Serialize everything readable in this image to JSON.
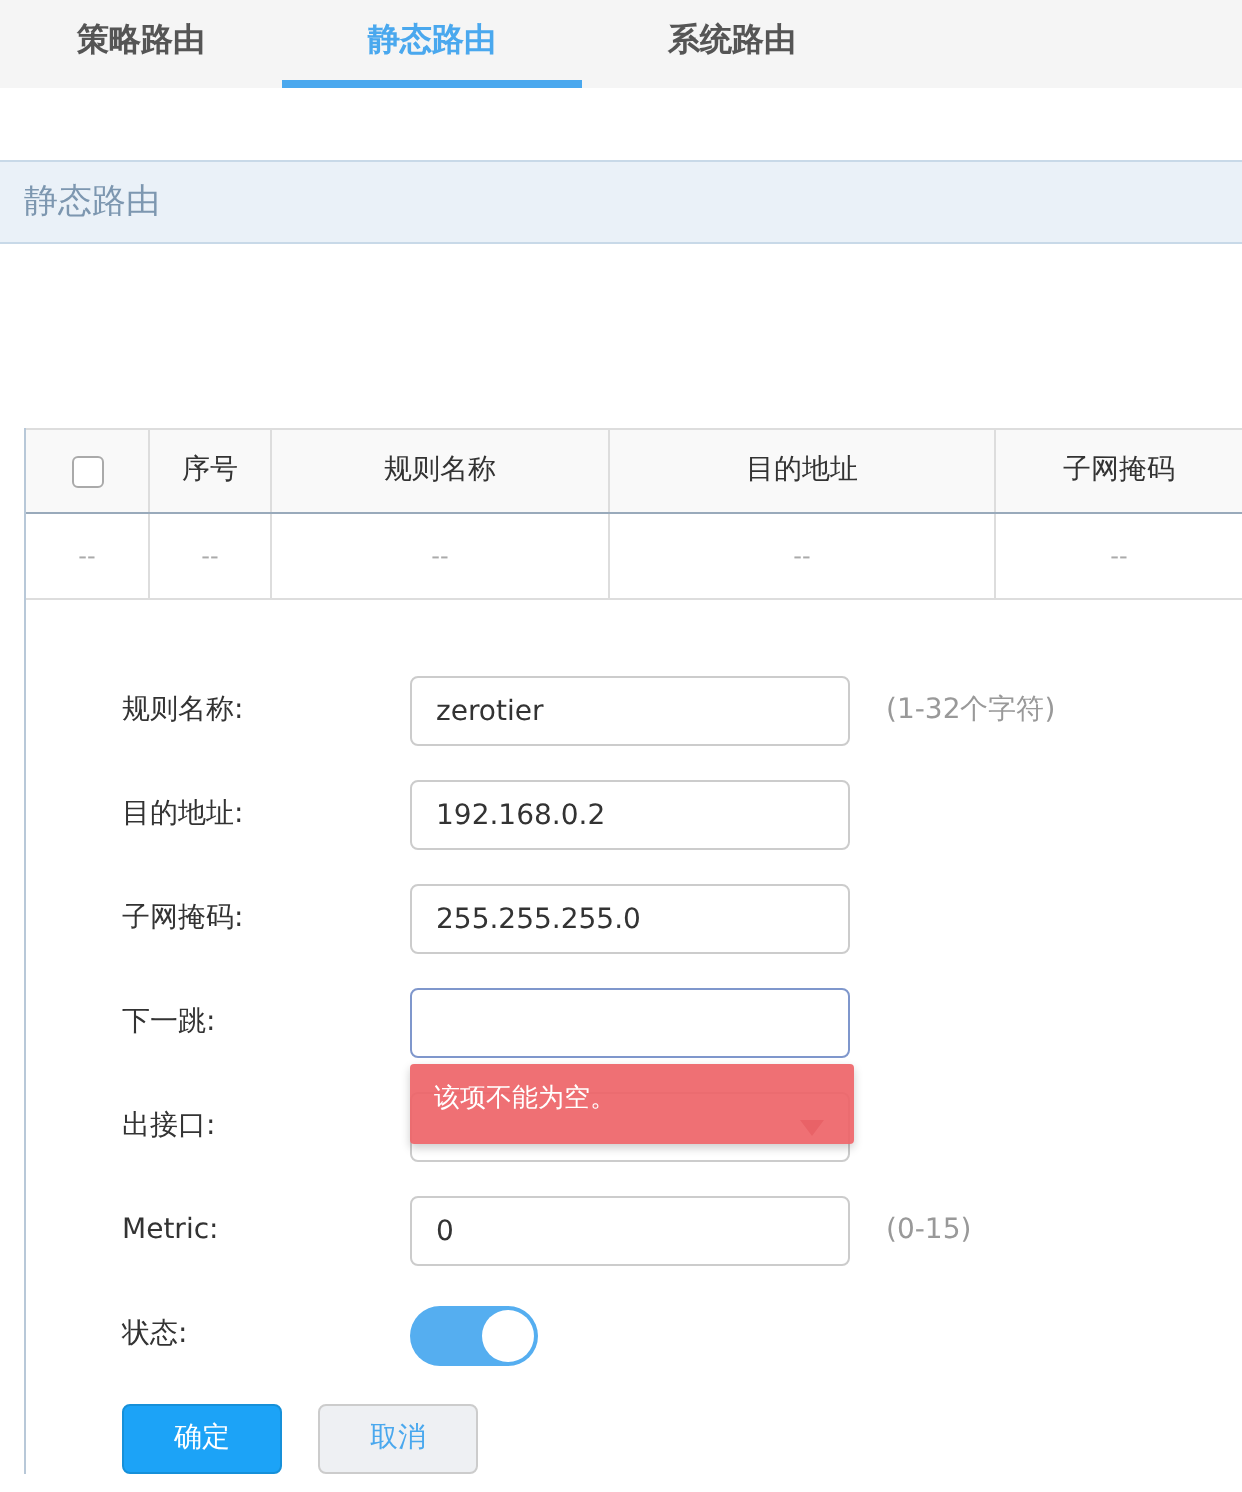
{
  "tabs": [
    {
      "label": "策略路由",
      "selected": false
    },
    {
      "label": "静态路由",
      "selected": true
    },
    {
      "label": "系统路由",
      "selected": false
    }
  ],
  "section_title": "静态路由",
  "table": {
    "select_all_checked": false,
    "columns": [
      "序号",
      "规则名称",
      "目的地址",
      "子网掩码"
    ],
    "rows": [
      {
        "check_cell": "--",
        "cells": [
          "--",
          "--",
          "--",
          "--"
        ]
      }
    ]
  },
  "form": {
    "fields": [
      {
        "kind": "text",
        "label": "规则名称:",
        "value": "zerotier",
        "hint": "(1-32个字符)",
        "focused": false
      },
      {
        "kind": "text",
        "label": "目的地址:",
        "value": "192.168.0.2",
        "focused": false
      },
      {
        "kind": "text",
        "label": "子网掩码:",
        "value": "255.255.255.0",
        "focused": false
      },
      {
        "kind": "text",
        "label": "下一跳:",
        "focused": true,
        "error": "该项不能为空。"
      },
      {
        "kind": "select",
        "label": "出接口:"
      },
      {
        "kind": "text",
        "label": "Metric:",
        "value": "0",
        "hint": "(0-15)",
        "focused": false
      },
      {
        "kind": "toggle",
        "label": "状态:",
        "on": true
      }
    ],
    "buttons": [
      {
        "label": "确定",
        "kind": "primary"
      },
      {
        "label": "取消",
        "kind": "secondary"
      }
    ]
  }
}
